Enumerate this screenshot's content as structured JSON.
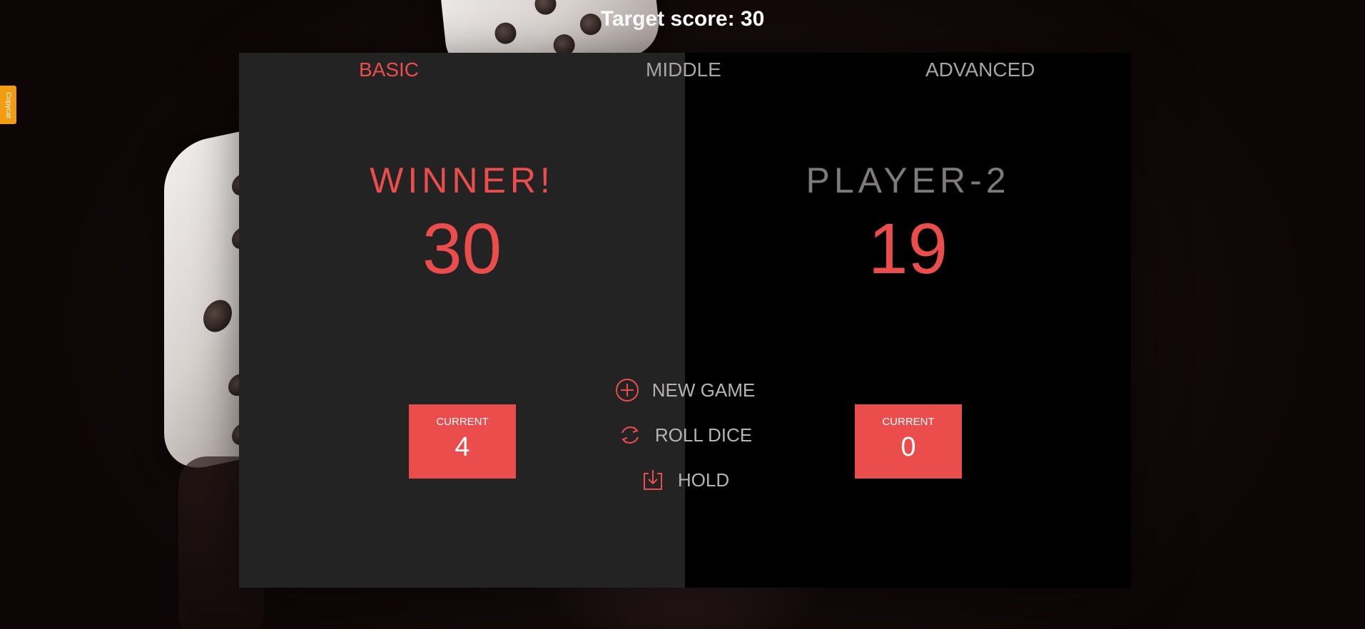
{
  "header": {
    "target_score_text": "Target score: 30"
  },
  "side_tab": {
    "label": "Copycat",
    "color": "#f39c12"
  },
  "levels": [
    {
      "label": "BASIC",
      "active": true
    },
    {
      "label": "MIDDLE",
      "active": false
    },
    {
      "label": "ADVANCED",
      "active": false
    }
  ],
  "players": [
    {
      "name": "WINNER!",
      "score": "30",
      "current_label": "CURRENT",
      "current_score": "4",
      "winner": true
    },
    {
      "name": "PLAYER-2",
      "score": "19",
      "current_label": "CURRENT",
      "current_score": "0",
      "winner": false
    }
  ],
  "controls": {
    "new_game": "NEW GAME",
    "roll_dice": "ROLL DICE",
    "hold": "HOLD",
    "icons": [
      "plus-circle-icon",
      "refresh-icon",
      "download-icon"
    ]
  },
  "colors": {
    "accent": "#eb4d4d",
    "left_panel": "#232323",
    "right_panel": "#000000"
  }
}
